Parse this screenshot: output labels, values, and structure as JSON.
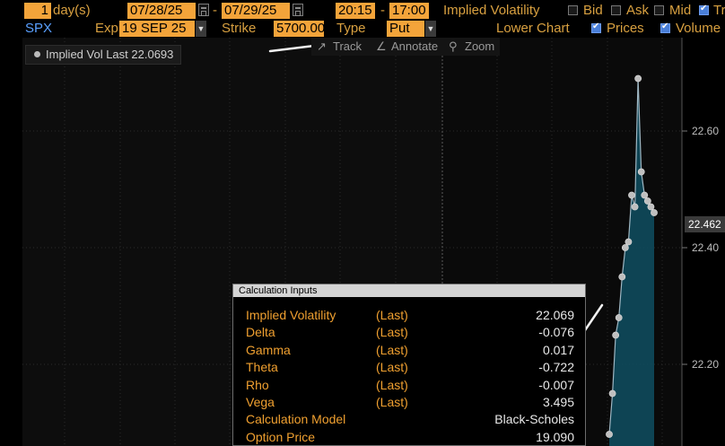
{
  "toolbar": {
    "period_value": "1",
    "period_unit": "day(s)",
    "start_date": "07/28/25",
    "range_sep": "-",
    "end_date": "07/29/25",
    "start_time": "20:15",
    "time_sep": "-",
    "end_time": "17:00",
    "study_label": "Implied Volatility",
    "bid_label": "Bid",
    "ask_label": "Ask",
    "mid_label": "Mid",
    "tr_label": "Tr",
    "ticker": "SPX",
    "exp_label": "Exp",
    "exp_value": "19 SEP 25",
    "strike_label": "Strike",
    "strike_value": "5700.00",
    "type_label": "Type",
    "type_value": "Put",
    "lower_chart_label": "Lower Chart",
    "prices_label": "Prices",
    "volume_label": "Volume"
  },
  "chart_tools": {
    "track_label": "Track",
    "annotate_label": "Annotate",
    "zoom_label": "Zoom"
  },
  "legend": {
    "text": "Implied Vol Last 22.0693"
  },
  "last_price_label": "22.462",
  "chart_data": {
    "type": "area",
    "ylim": [
      22.06,
      22.76
    ],
    "y_ticks": [
      22.2,
      22.4,
      22.6
    ],
    "y_tick_labels": [
      "22.20",
      "22.40",
      "22.60"
    ],
    "x": [
      0,
      1,
      2,
      3,
      4,
      5,
      6,
      7,
      8,
      9,
      10,
      11,
      12,
      13,
      14
    ],
    "values": [
      22.08,
      22.15,
      22.25,
      22.28,
      22.35,
      22.4,
      22.41,
      22.49,
      22.47,
      22.69,
      22.53,
      22.49,
      22.48,
      22.47,
      22.46
    ],
    "accent_color": "#0e4a5c",
    "line_color": "#9fb7c3"
  },
  "panel": {
    "title": "Calculation Inputs",
    "rows": [
      {
        "label": "Implied Volatility",
        "source": "(Last)",
        "value": "22.069"
      },
      {
        "label": "Delta",
        "source": "(Last)",
        "value": "-0.076"
      },
      {
        "label": "Gamma",
        "source": "(Last)",
        "value": "0.017"
      },
      {
        "label": "Theta",
        "source": "(Last)",
        "value": "-0.722"
      },
      {
        "label": "Rho",
        "source": "(Last)",
        "value": "-0.007"
      },
      {
        "label": "Vega",
        "source": "(Last)",
        "value": "3.495"
      },
      {
        "label": "Calculation Model",
        "source": "",
        "value": "Black-Scholes"
      },
      {
        "label": "Option Price",
        "source": "",
        "value": "19.090"
      }
    ]
  }
}
